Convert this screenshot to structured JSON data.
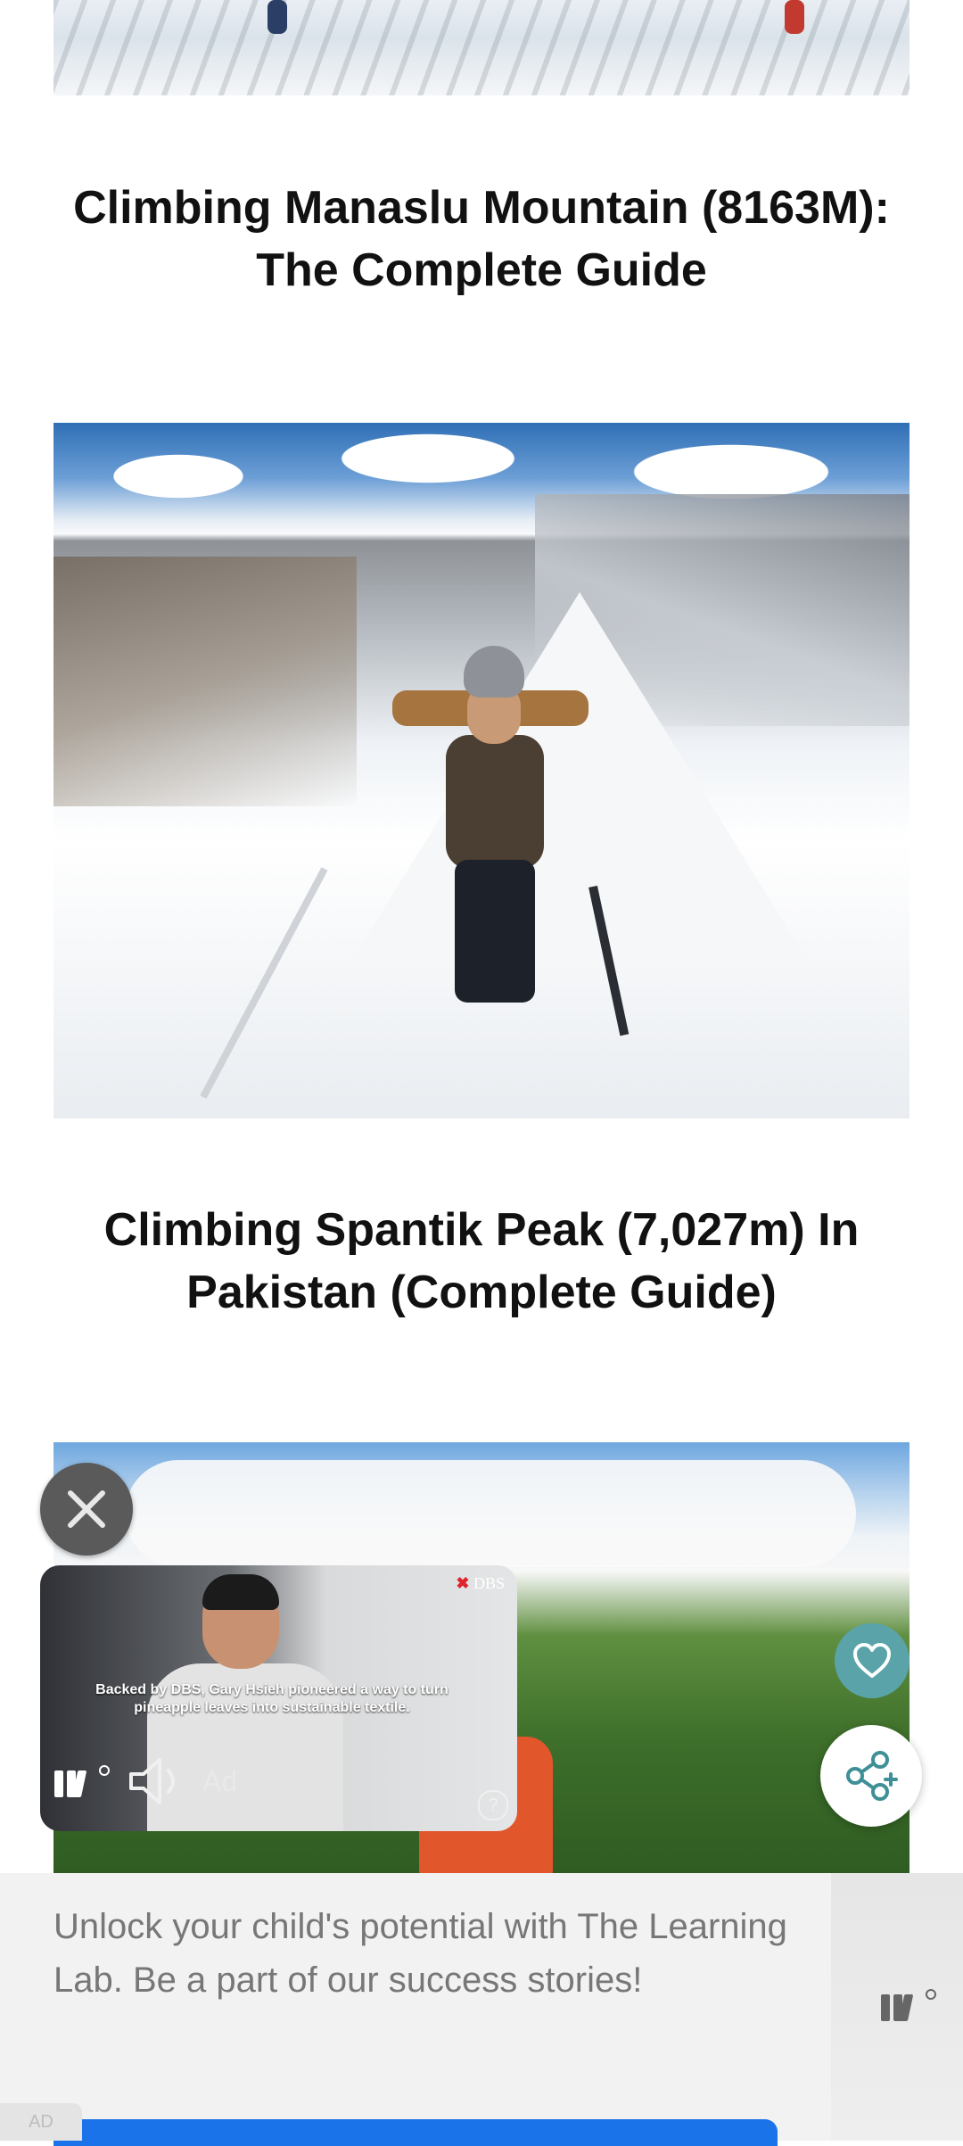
{
  "articles": [
    {
      "title": "Climbing Manaslu Mountain (8163M): The Complete Guide"
    },
    {
      "title": "Climbing Spantik Peak (7,027m) In Pakistan (Complete Guide)"
    }
  ],
  "video_ad": {
    "brand": "DBS",
    "caption": "Backed by DBS, Gary Hsieh pioneered a way to turn pineapple leaves into sustainable textile.",
    "ad_label": "Ad",
    "help": "?"
  },
  "banner_ad": {
    "text": "Unlock your child's potential with The Learning Lab. Be a part of our success stories!",
    "badge": "AD"
  },
  "icons": {
    "close": "close-icon",
    "like": "heart-icon",
    "share": "share-icon",
    "volume": "volume-icon",
    "brand_logo": "brand-logo-icon"
  },
  "colors": {
    "like_button": "#5aa3a9",
    "cta": "#1a73e8",
    "brand_red": "#e0242b"
  }
}
